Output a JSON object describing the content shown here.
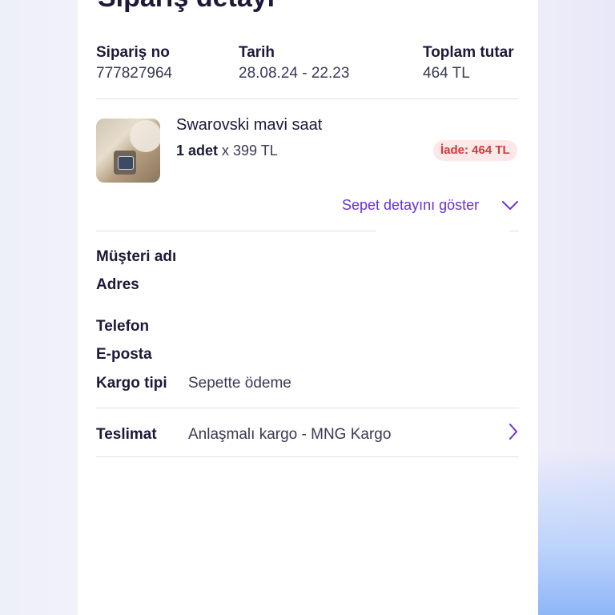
{
  "page": {
    "heading": "Sipariş detayı"
  },
  "order_info": {
    "order_no_label": "Sipariş no",
    "order_no_value": "777827964",
    "date_label": "Tarih",
    "date_value": "28.08.24 - 22.23",
    "total_label": "Toplam tutar",
    "total_value": "464 TL"
  },
  "product": {
    "name": "Swarovski mavi saat",
    "quantity": "1 adet",
    "unit_price": " x 399 TL",
    "refund_badge": "İade: 464 TL",
    "image_icon": "product-thumbnail-watch"
  },
  "cart_detail": {
    "label": "Sepet detayını göster",
    "icon": "chevron-down-icon"
  },
  "customer": {
    "name_label": "Müşteri adı",
    "address_label": "Adres",
    "phone_label": "Telefon",
    "email_label": "E-posta",
    "shipping_type_label": "Kargo tipi",
    "shipping_type_value": "Sepette ödeme"
  },
  "delivery": {
    "label": "Teslimat",
    "value": "Anlaşmalı kargo - MNG Kargo",
    "icon": "chevron-right-icon"
  },
  "colors": {
    "accent": "#6b2fd6",
    "refund_text": "#d4393b",
    "refund_bg": "#fde8e8",
    "text_dark": "#1b1a3a"
  }
}
